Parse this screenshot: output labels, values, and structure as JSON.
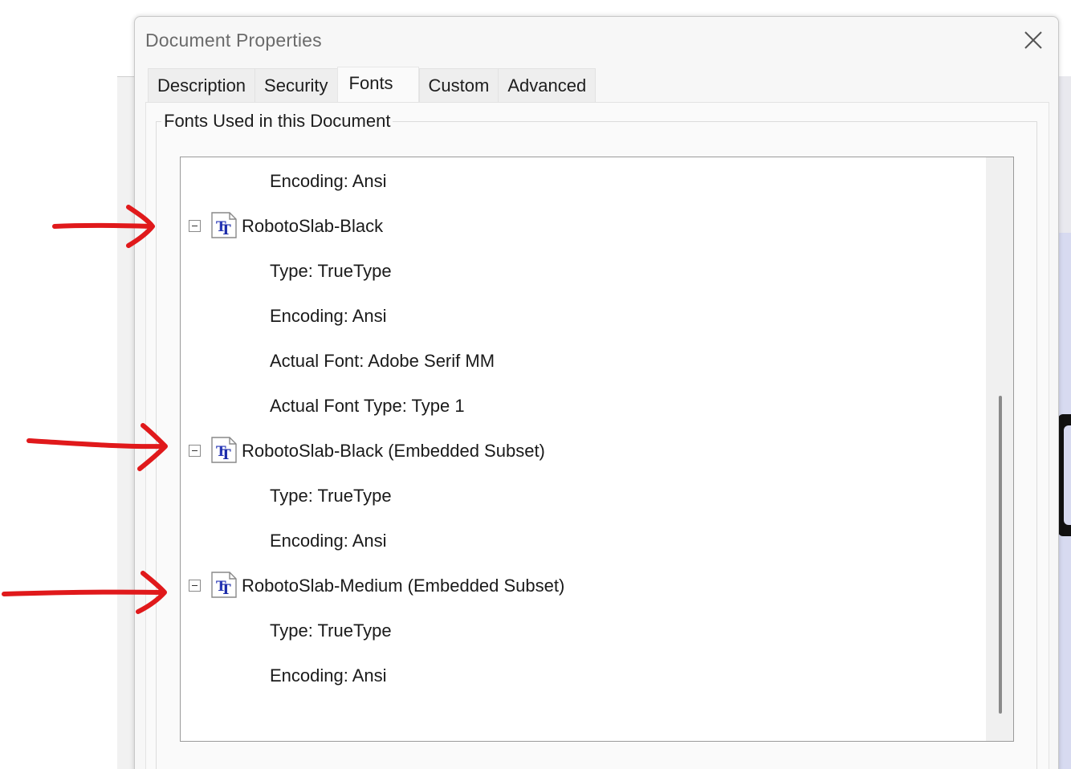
{
  "dialog": {
    "title": "Document Properties",
    "close_icon": "close-icon"
  },
  "tabs": [
    {
      "label": "Description",
      "active": false
    },
    {
      "label": "Security",
      "active": false
    },
    {
      "label": "Fonts",
      "active": true
    },
    {
      "label": "Custom",
      "active": false
    },
    {
      "label": "Advanced",
      "active": false
    }
  ],
  "fonts_panel": {
    "group_label": "Fonts Used in this Document",
    "rows": {
      "r0": "Encoding: Ansi",
      "f1": "RobotoSlab-Black",
      "f1_type": "Type: TrueType",
      "f1_enc": "Encoding: Ansi",
      "f1_actual": "Actual Font: Adobe Serif MM",
      "f1_actual_type": "Actual Font Type: Type 1",
      "f2": "RobotoSlab-Black (Embedded Subset)",
      "f2_type": "Type: TrueType",
      "f2_enc": "Encoding: Ansi",
      "f3": "RobotoSlab-Medium (Embedded Subset)",
      "f3_type": "Type: TrueType",
      "f3_enc": "Encoding: Ansi"
    }
  },
  "annotations": {
    "arrow_color": "#e0191b",
    "arrow_icon": "red-arrow-annotation"
  }
}
